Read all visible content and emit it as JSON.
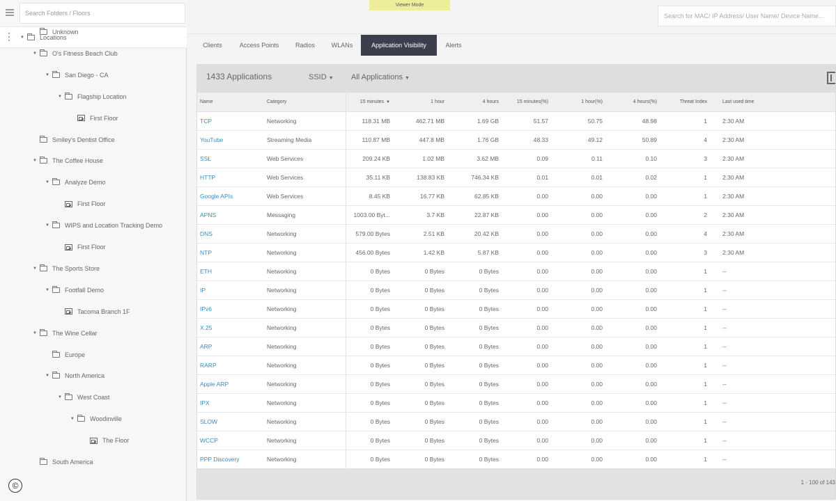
{
  "banner": "Viewer Mode",
  "sidebar": {
    "search_placeholder": "Search Folders / Floors",
    "root_label": "Locations",
    "nodes": [
      {
        "label": "Unknown",
        "type": "folder",
        "expanded": false
      },
      {
        "label": "O's Fitness Beach Club",
        "type": "folder",
        "expanded": true
      },
      {
        "label": "San Diego - CA",
        "type": "folder",
        "expanded": true
      },
      {
        "label": "Flagship Location",
        "type": "folder",
        "expanded": true
      },
      {
        "label": "First Floor",
        "type": "floor",
        "expanded": false
      },
      {
        "label": "Smiley's Dentist Office",
        "type": "folder",
        "expanded": false
      },
      {
        "label": "The Coffee House",
        "type": "folder",
        "expanded": true
      },
      {
        "label": "Analyze Demo",
        "type": "folder",
        "expanded": true
      },
      {
        "label": "First Floor",
        "type": "floor",
        "expanded": false
      },
      {
        "label": "WIPS and Location Tracking Demo",
        "type": "folder",
        "expanded": true
      },
      {
        "label": "First Floor",
        "type": "floor",
        "expanded": false
      },
      {
        "label": "The Sports Store",
        "type": "folder",
        "expanded": true
      },
      {
        "label": "Footfall Demo",
        "type": "folder",
        "expanded": true
      },
      {
        "label": "Tacoma Branch 1F",
        "type": "floor",
        "expanded": false
      },
      {
        "label": "The Wine Cellar",
        "type": "folder",
        "expanded": true
      },
      {
        "label": "Europe",
        "type": "folder",
        "expanded": false
      },
      {
        "label": "North America",
        "type": "folder",
        "expanded": true
      },
      {
        "label": "West Coast",
        "type": "folder",
        "expanded": true
      },
      {
        "label": "Woodinville",
        "type": "folder",
        "expanded": true
      },
      {
        "label": "The Floor",
        "type": "floor",
        "expanded": false
      },
      {
        "label": "South America",
        "type": "folder",
        "expanded": false
      }
    ]
  },
  "header": {
    "search_placeholder": "Search for MAC/ IP Address/ User Name/ Device Name..."
  },
  "tabs": [
    {
      "label": "Clients",
      "active": false
    },
    {
      "label": "Access Points",
      "active": false
    },
    {
      "label": "Radios",
      "active": false
    },
    {
      "label": "WLANs",
      "active": false
    },
    {
      "label": "Application Visibility",
      "active": true
    },
    {
      "label": "Alerts",
      "active": false
    }
  ],
  "panel": {
    "count_label": "1433 Applications",
    "ssid_label": "SSID",
    "filter_label": "All Applications",
    "columns": [
      "Name",
      "Category",
      "15 minutes",
      "1 hour",
      "4 hours",
      "15 minutes(%)",
      "1 hour(%)",
      "4 hours(%)",
      "Threat Index",
      "Last used time"
    ],
    "rows": [
      [
        "TCP",
        "Networking",
        "118.31 MB",
        "462.71 MB",
        "1.69 GB",
        "51.57",
        "50.75",
        "48.98",
        "1",
        "2:30 AM"
      ],
      [
        "YouTube",
        "Streaming Media",
        "110.87 MB",
        "447.8 MB",
        "1.76 GB",
        "48.33",
        "49.12",
        "50.89",
        "4",
        "2:30 AM"
      ],
      [
        "SSL",
        "Web Services",
        "209.24 KB",
        "1.02 MB",
        "3.62 MB",
        "0.09",
        "0.11",
        "0.10",
        "3",
        "2:30 AM"
      ],
      [
        "HTTP",
        "Web Services",
        "35.11 KB",
        "138.83 KB",
        "746.34 KB",
        "0.01",
        "0.01",
        "0.02",
        "1",
        "2:30 AM"
      ],
      [
        "Google APIs",
        "Web Services",
        "8.45 KB",
        "16.77 KB",
        "62.85 KB",
        "0.00",
        "0.00",
        "0.00",
        "1",
        "2:30 AM"
      ],
      [
        "APNS",
        "Messaging",
        "1003.00 Byt...",
        "3.7 KB",
        "22.87 KB",
        "0.00",
        "0.00",
        "0.00",
        "2",
        "2:30 AM"
      ],
      [
        "DNS",
        "Networking",
        "579.00 Bytes",
        "2.51 KB",
        "20.42 KB",
        "0.00",
        "0.00",
        "0.00",
        "4",
        "2:30 AM"
      ],
      [
        "NTP",
        "Networking",
        "456.00 Bytes",
        "1.42 KB",
        "5.87 KB",
        "0.00",
        "0.00",
        "0.00",
        "3",
        "2:30 AM"
      ],
      [
        "ETH",
        "Networking",
        "0 Bytes",
        "0 Bytes",
        "0 Bytes",
        "0.00",
        "0.00",
        "0.00",
        "1",
        "--"
      ],
      [
        "IP",
        "Networking",
        "0 Bytes",
        "0 Bytes",
        "0 Bytes",
        "0.00",
        "0.00",
        "0.00",
        "1",
        "--"
      ],
      [
        "IPv6",
        "Networking",
        "0 Bytes",
        "0 Bytes",
        "0 Bytes",
        "0.00",
        "0.00",
        "0.00",
        "1",
        "--"
      ],
      [
        "X.25",
        "Networking",
        "0 Bytes",
        "0 Bytes",
        "0 Bytes",
        "0.00",
        "0.00",
        "0.00",
        "1",
        "--"
      ],
      [
        "ARP",
        "Networking",
        "0 Bytes",
        "0 Bytes",
        "0 Bytes",
        "0.00",
        "0.00",
        "0.00",
        "1",
        "--"
      ],
      [
        "RARP",
        "Networking",
        "0 Bytes",
        "0 Bytes",
        "0 Bytes",
        "0.00",
        "0.00",
        "0.00",
        "1",
        "--"
      ],
      [
        "Apple ARP",
        "Networking",
        "0 Bytes",
        "0 Bytes",
        "0 Bytes",
        "0.00",
        "0.00",
        "0.00",
        "1",
        "--"
      ],
      [
        "IPX",
        "Networking",
        "0 Bytes",
        "0 Bytes",
        "0 Bytes",
        "0.00",
        "0.00",
        "0.00",
        "1",
        "--"
      ],
      [
        "SLOW",
        "Networking",
        "0 Bytes",
        "0 Bytes",
        "0 Bytes",
        "0.00",
        "0.00",
        "0.00",
        "1",
        "--"
      ],
      [
        "WCCP",
        "Networking",
        "0 Bytes",
        "0 Bytes",
        "0 Bytes",
        "0.00",
        "0.00",
        "0.00",
        "1",
        "--"
      ],
      [
        "PPP Discovery",
        "Networking",
        "0 Bytes",
        "0 Bytes",
        "0 Bytes",
        "0.00",
        "0.00",
        "0.00",
        "1",
        "--"
      ]
    ],
    "pager_label": "1 - 100 of 143"
  },
  "colors": {
    "active_tab": "#3c3f4b",
    "link": "#3a8bbf",
    "banner": "#eeee9a"
  },
  "icons": {
    "menu": "hamburger-icon",
    "folder": "folder-icon",
    "floor": "floor-plan-icon",
    "copyright": "copyright-icon",
    "columns": "column-toggle-icon"
  }
}
